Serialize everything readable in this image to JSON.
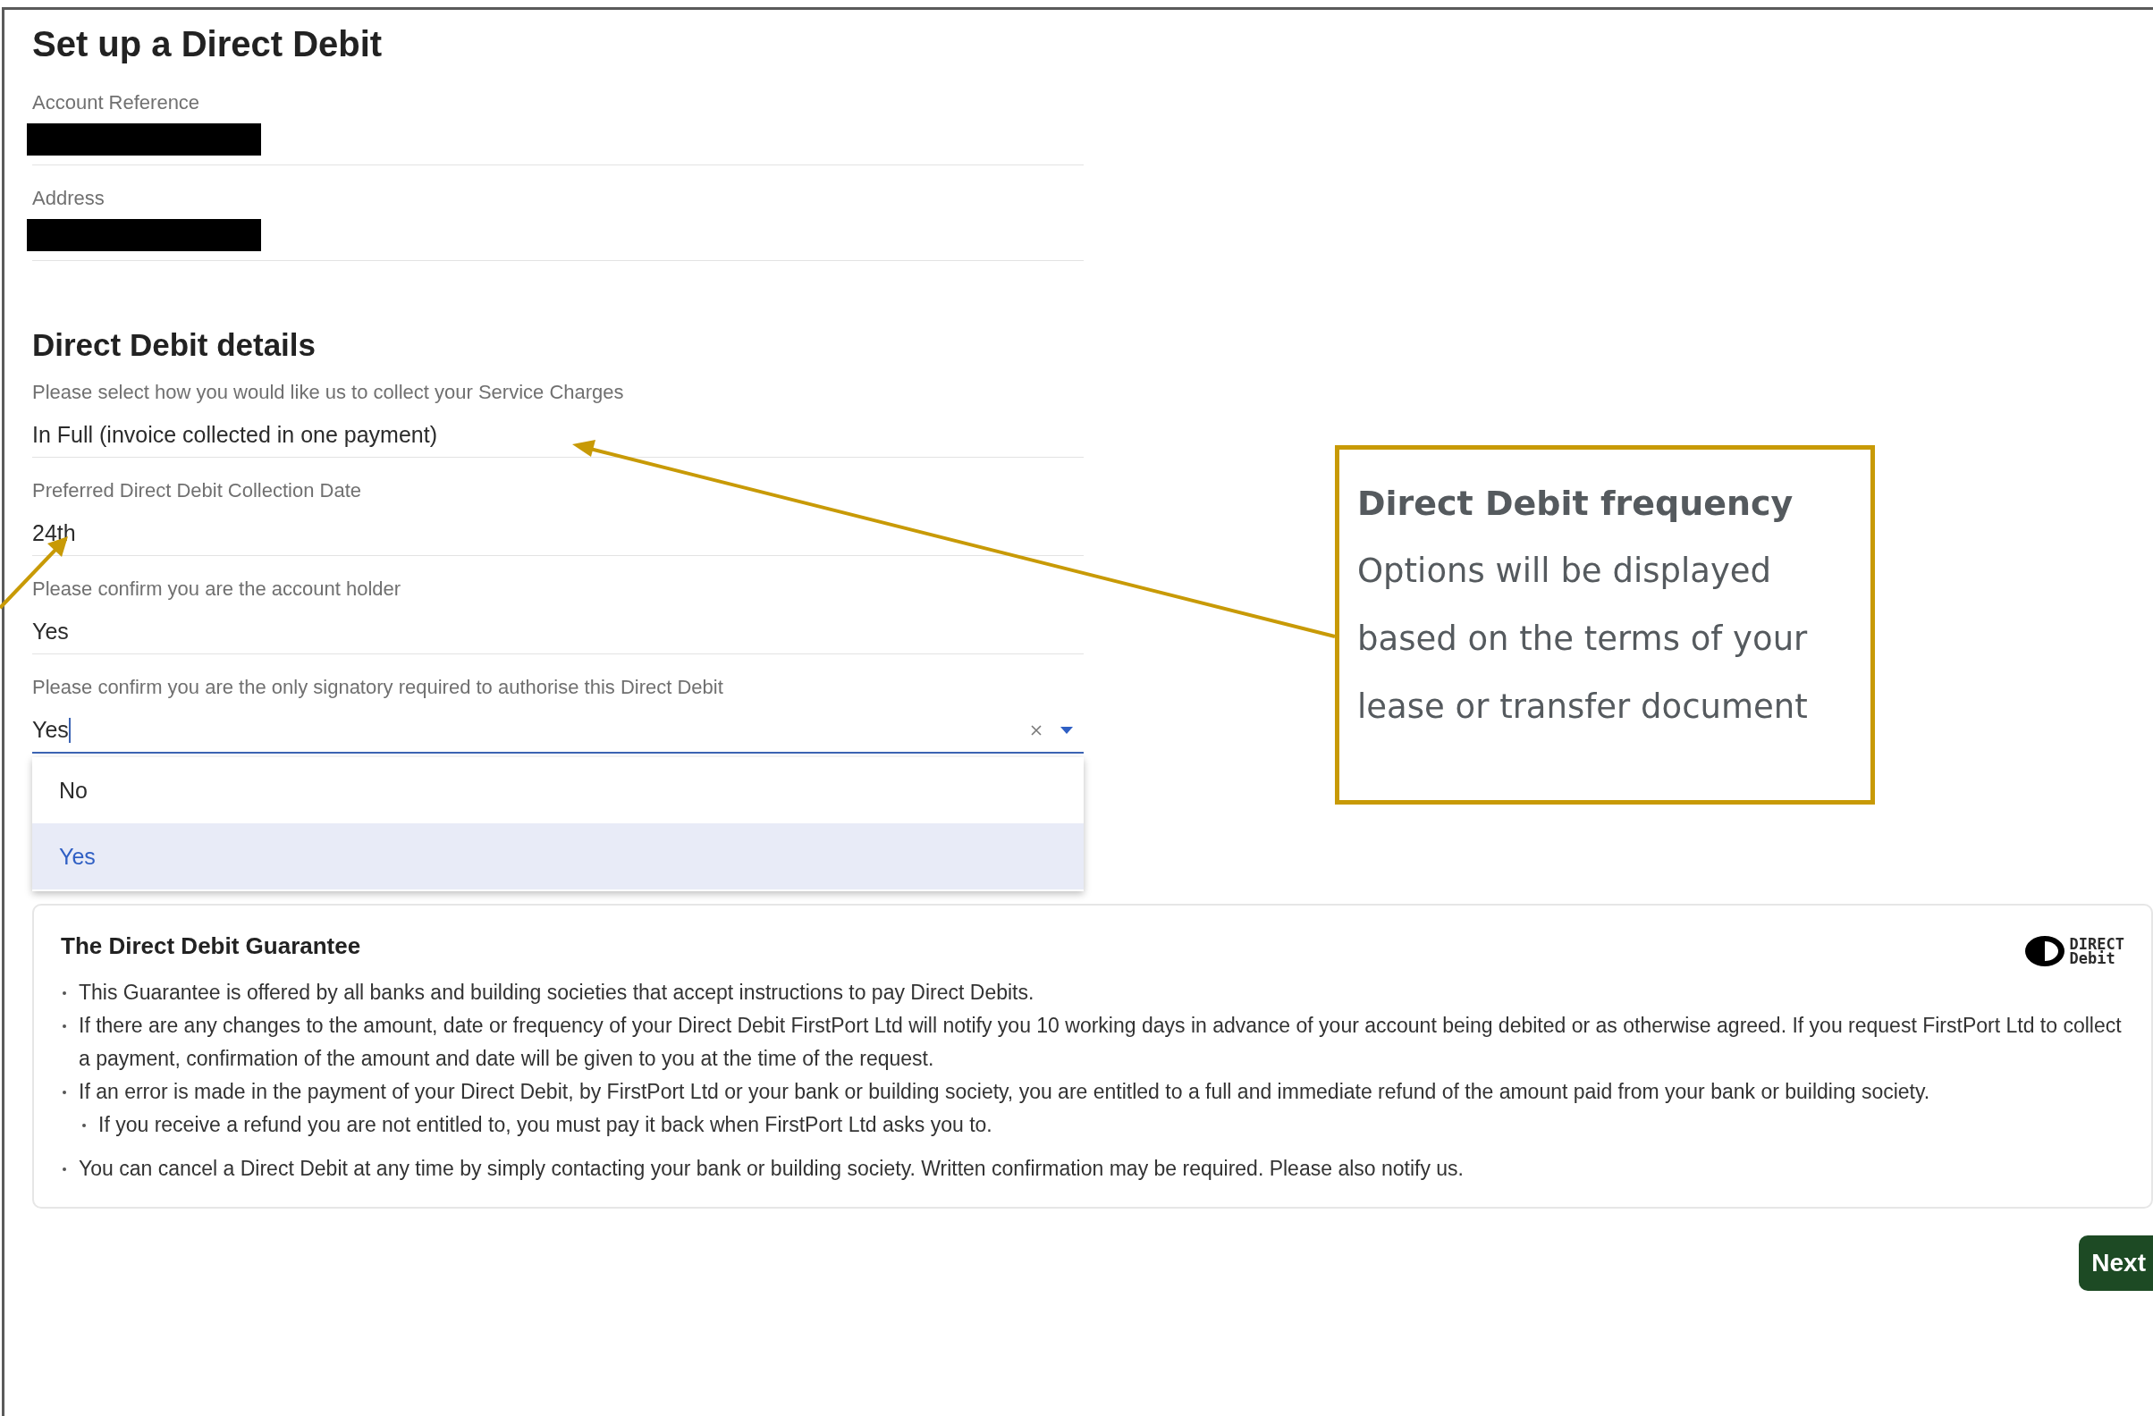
{
  "page": {
    "title": "Set up a Direct Debit"
  },
  "account_fields": [
    {
      "label": "Account Reference",
      "redacted": true
    },
    {
      "label": "Address",
      "redacted": true
    }
  ],
  "details": {
    "heading": "Direct Debit details",
    "fields": [
      {
        "label": "Please select how you would like us to collect your Service Charges",
        "value": "In Full (invoice collected in one payment)"
      },
      {
        "label": "Preferred Direct Debit Collection Date",
        "value": "24th"
      },
      {
        "label": "Please confirm you are the account holder",
        "value": "Yes"
      }
    ],
    "signatory_field": {
      "label": "Please confirm you are the only signatory required to authorise this Direct Debit",
      "value": "Yes",
      "focused": true,
      "options": [
        {
          "label": "No",
          "selected": false
        },
        {
          "label": "Yes",
          "selected": true
        }
      ]
    }
  },
  "guarantee": {
    "title": "The Direct Debit Guarantee",
    "logo": {
      "line_1": "DIRECT",
      "line_2": "Debit"
    },
    "items": [
      {
        "text": "This Guarantee is offered by all banks and building societies that accept instructions to pay Direct Debits."
      },
      {
        "text": "If there are any changes to the amount, date or frequency of your Direct Debit FirstPort Ltd will notify you 10 working days in advance of your account being debited or as otherwise agreed. If you request FirstPort Ltd to collect a payment, confirmation of the amount and date will be given to you at the time of the request."
      },
      {
        "text": "If an error is made in the payment of your Direct Debit, by FirstPort Ltd or your bank or building society, you are entitled to a full and immediate refund of the amount paid from your bank or building society.",
        "children": [
          {
            "text": "If you receive a refund you are not entitled to, you must pay it back when FirstPort Ltd asks you to."
          }
        ]
      },
      {
        "text": "You can cancel a Direct Debit at any time by simply contacting your bank or building society. Written confirmation may be required. Please also notify us."
      }
    ]
  },
  "next_button": "Next",
  "callout": {
    "title": "Direct Debit frequency",
    "text": "Options will be displayed based on the terms of your lease or transfer document"
  }
}
